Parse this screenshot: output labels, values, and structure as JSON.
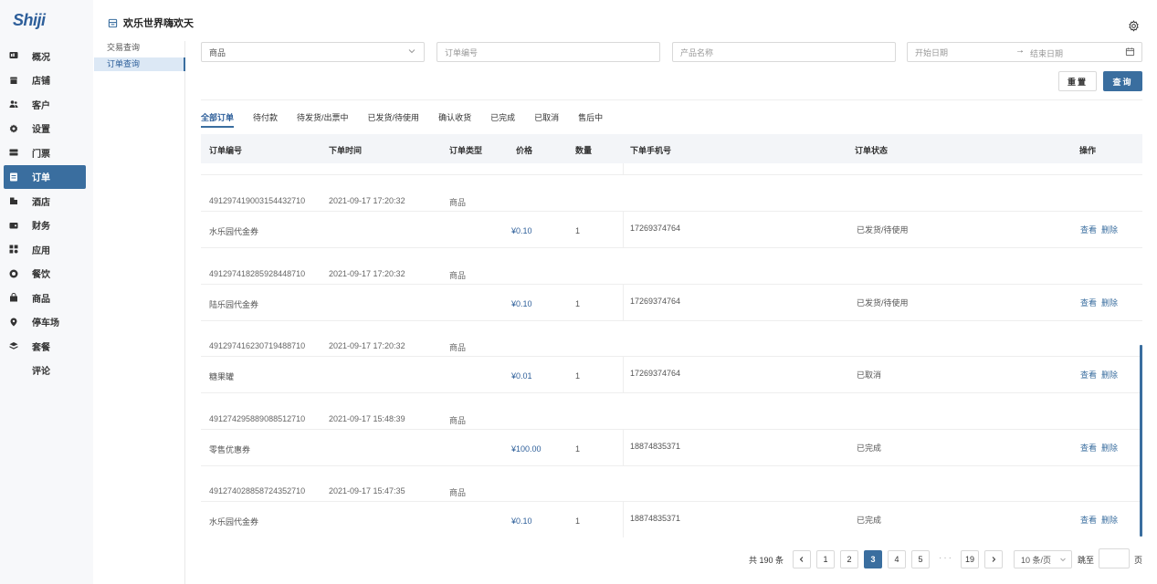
{
  "app": {
    "logo": "Shiji"
  },
  "nav": {
    "items": [
      {
        "label": "概况",
        "icon": "dashboard-icon"
      },
      {
        "label": "店铺",
        "icon": "store-icon"
      },
      {
        "label": "客户",
        "icon": "users-icon"
      },
      {
        "label": "设置",
        "icon": "gear-icon"
      },
      {
        "label": "门票",
        "icon": "ticket-icon"
      },
      {
        "label": "订单",
        "icon": "order-icon",
        "active": true
      },
      {
        "label": "酒店",
        "icon": "hotel-icon"
      },
      {
        "label": "财务",
        "icon": "wallet-icon"
      },
      {
        "label": "应用",
        "icon": "apps-icon"
      },
      {
        "label": "餐饮",
        "icon": "dining-icon"
      },
      {
        "label": "商品",
        "icon": "bag-icon"
      },
      {
        "label": "停车场",
        "icon": "location-icon"
      },
      {
        "label": "套餐",
        "icon": "layers-icon"
      },
      {
        "label": "评论",
        "icon": ""
      }
    ]
  },
  "header": {
    "title": "欢乐世界嗨欢天"
  },
  "subnav": {
    "items": [
      "交易查询",
      "订单查询"
    ]
  },
  "filters": {
    "type_select": "商品",
    "order_no_placeholder": "订单编号",
    "product_name_placeholder": "产品名称",
    "start_date_placeholder": "开始日期",
    "range_separator": "→",
    "end_date_placeholder": "结束日期"
  },
  "actions": {
    "reset": "重置",
    "search": "查询"
  },
  "tabs": [
    "全部订单",
    "待付款",
    "待发货/出票中",
    "已发货/待使用",
    "确认收货",
    "已完成",
    "已取消",
    "售后中"
  ],
  "table": {
    "columns": [
      "订单编号",
      "下单时间",
      "订单类型",
      "价格",
      "数量",
      "下单手机号",
      "订单状态",
      "操作"
    ],
    "action_view": "查看",
    "action_delete": "删除",
    "groups": [
      {
        "order_no": "491297419003154432710",
        "time": "2021-09-17 17:20:32",
        "type": "商品",
        "product": "水乐园代金券",
        "price": "¥0.10",
        "qty": "1",
        "phone": "17269374764",
        "status": "已发货/待使用"
      },
      {
        "order_no": "491297418285928448710",
        "time": "2021-09-17 17:20:32",
        "type": "商品",
        "product": "陆乐园代金券",
        "price": "¥0.10",
        "qty": "1",
        "phone": "17269374764",
        "status": "已发货/待使用"
      },
      {
        "order_no": "491297416230719488710",
        "time": "2021-09-17 17:20:32",
        "type": "商品",
        "product": "糖果罐",
        "price": "¥0.01",
        "qty": "1",
        "phone": "17269374764",
        "status": "已取消"
      },
      {
        "order_no": "491274295889088512710",
        "time": "2021-09-17 15:48:39",
        "type": "商品",
        "product": "零售优惠券",
        "price": "¥100.00",
        "qty": "1",
        "phone": "18874835371",
        "status": "已完成"
      },
      {
        "order_no": "491274028858724352710",
        "time": "2021-09-17 15:47:35",
        "type": "商品",
        "product": "水乐园代金券",
        "price": "¥0.10",
        "qty": "1",
        "phone": "18874835371",
        "status": "已完成"
      }
    ]
  },
  "pagination": {
    "total": "共 190 条",
    "pages": [
      "1",
      "2",
      "3",
      "4",
      "5"
    ],
    "current": "3",
    "ellipsis": "···",
    "last": "19",
    "page_size": "10 条/页",
    "jump_label": "跳至",
    "page_suffix": "页"
  },
  "colors": {
    "accent": "#3a6e9f",
    "nav_bg": "#f7f8fa",
    "header_bg": "#f3f5f8"
  }
}
